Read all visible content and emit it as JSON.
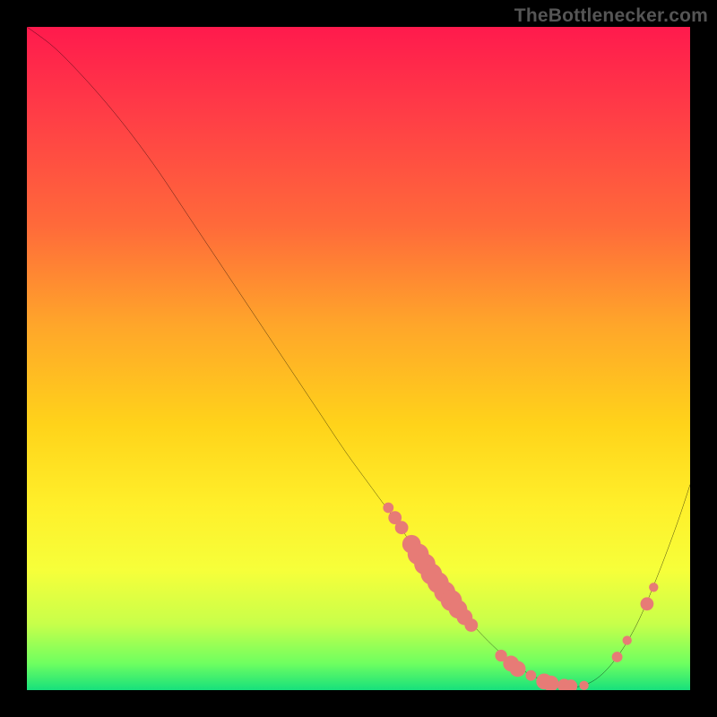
{
  "attribution": "TheBottlenecker.com",
  "colors": {
    "curve_stroke": "#000000",
    "marker_fill": "#e77b76",
    "background": "#000000",
    "gradient_top": "#ff1a4d",
    "gradient_bottom": "#17e07c"
  },
  "chart_data": {
    "type": "line",
    "title": "",
    "xlabel": "",
    "ylabel": "",
    "xlim": [
      0,
      100
    ],
    "ylim": [
      0,
      100
    ],
    "grid": false,
    "legend": false,
    "series": [
      {
        "name": "curve",
        "x": [
          0,
          4,
          8,
          12,
          16,
          20,
          24,
          28,
          32,
          36,
          40,
          44,
          48,
          52,
          56,
          59,
          62,
          65,
          68,
          71,
          74,
          77,
          80,
          83,
          86,
          89,
          92,
          95,
          98,
          100
        ],
        "y": [
          100,
          97,
          93,
          88.5,
          83.5,
          78,
          72,
          66,
          60,
          54,
          48,
          42,
          36,
          30.5,
          25,
          20.5,
          16.5,
          12.5,
          9,
          6,
          3.5,
          1.8,
          0.8,
          0.5,
          1.8,
          5,
          10,
          17,
          25,
          31
        ]
      }
    ],
    "markers": [
      {
        "x": 54.5,
        "y": 27.5,
        "r": 0.8
      },
      {
        "x": 55.5,
        "y": 26.0,
        "r": 1.0
      },
      {
        "x": 56.5,
        "y": 24.5,
        "r": 1.0
      },
      {
        "x": 58.0,
        "y": 22.0,
        "r": 1.4
      },
      {
        "x": 59.0,
        "y": 20.5,
        "r": 1.6
      },
      {
        "x": 60.0,
        "y": 19.0,
        "r": 1.6
      },
      {
        "x": 61.0,
        "y": 17.5,
        "r": 1.6
      },
      {
        "x": 62.0,
        "y": 16.2,
        "r": 1.6
      },
      {
        "x": 63.0,
        "y": 14.8,
        "r": 1.6
      },
      {
        "x": 64.0,
        "y": 13.5,
        "r": 1.6
      },
      {
        "x": 65.0,
        "y": 12.2,
        "r": 1.4
      },
      {
        "x": 66.0,
        "y": 11.0,
        "r": 1.2
      },
      {
        "x": 67.0,
        "y": 9.8,
        "r": 1.0
      },
      {
        "x": 71.5,
        "y": 5.2,
        "r": 0.9
      },
      {
        "x": 73.0,
        "y": 4.0,
        "r": 1.2
      },
      {
        "x": 74.0,
        "y": 3.2,
        "r": 1.2
      },
      {
        "x": 76.0,
        "y": 2.2,
        "r": 0.8
      },
      {
        "x": 78.0,
        "y": 1.3,
        "r": 1.2
      },
      {
        "x": 79.0,
        "y": 1.0,
        "r": 1.2
      },
      {
        "x": 81.0,
        "y": 0.7,
        "r": 1.0
      },
      {
        "x": 82.0,
        "y": 0.6,
        "r": 1.0
      },
      {
        "x": 84.0,
        "y": 0.7,
        "r": 0.7
      },
      {
        "x": 89.0,
        "y": 5.0,
        "r": 0.8
      },
      {
        "x": 90.5,
        "y": 7.5,
        "r": 0.7
      },
      {
        "x": 93.5,
        "y": 13.0,
        "r": 1.0
      },
      {
        "x": 94.5,
        "y": 15.5,
        "r": 0.7
      }
    ]
  }
}
